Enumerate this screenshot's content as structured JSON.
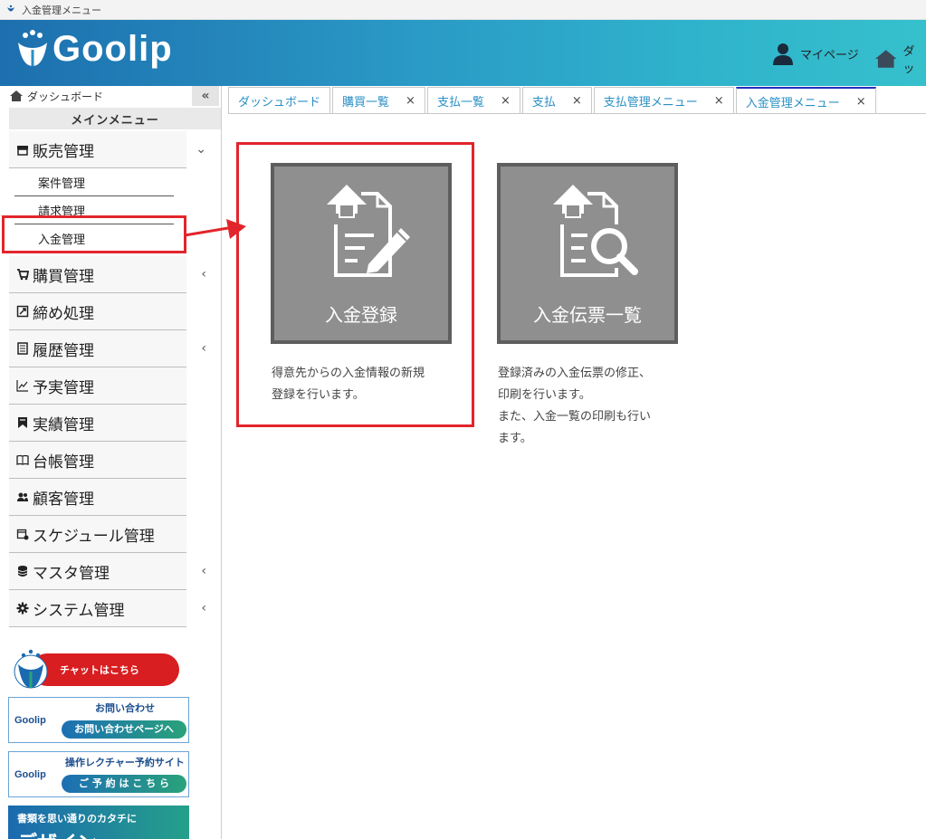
{
  "window": {
    "title": "入金管理メニュー"
  },
  "header": {
    "logo_text": "Goolip",
    "mypage_label": "マイページ",
    "dashboard_label": "ダッ"
  },
  "sidebar": {
    "top_label": "ダッシュボード",
    "collapse_label": "«",
    "main_menu_label": "メインメニュー",
    "items": [
      {
        "label": "販売管理",
        "icon": "store-icon",
        "chevron": "⌄"
      },
      {
        "label": "購買管理",
        "icon": "cart-icon",
        "chevron": "‹"
      },
      {
        "label": "締め処理",
        "icon": "close-process-icon",
        "chevron": ""
      },
      {
        "label": "履歴管理",
        "icon": "history-icon",
        "chevron": "‹"
      },
      {
        "label": "予実管理",
        "icon": "chart-icon",
        "chevron": ""
      },
      {
        "label": "実績管理",
        "icon": "bookmark-icon",
        "chevron": ""
      },
      {
        "label": "台帳管理",
        "icon": "book-icon",
        "chevron": ""
      },
      {
        "label": "顧客管理",
        "icon": "users-icon",
        "chevron": ""
      },
      {
        "label": "スケジュール管理",
        "icon": "calendar-icon",
        "chevron": ""
      },
      {
        "label": "マスタ管理",
        "icon": "database-icon",
        "chevron": "‹"
      },
      {
        "label": "システム管理",
        "icon": "gear-icon",
        "chevron": "‹"
      }
    ],
    "sub_items": [
      {
        "label": "案件管理"
      },
      {
        "label": "請求管理"
      },
      {
        "label": "入金管理"
      }
    ]
  },
  "banners": {
    "chat": "チャットはこちら",
    "inquiry_logo": "Goolip",
    "inquiry_title": "お問い合わせ",
    "inquiry_button": "お問い合わせページへ",
    "lecture_logo": "Goolip",
    "lecture_title": "操作レクチャー予約サイト",
    "lecture_button": "ご 予 約 は こ ち ら",
    "design_line1": "書類を思い通りのカタチに",
    "design_line2": "デザイン"
  },
  "tabs": [
    {
      "label": "ダッシュボード",
      "closable": false
    },
    {
      "label": "購買一覧",
      "closable": true
    },
    {
      "label": "支払一覧",
      "closable": true
    },
    {
      "label": "支払",
      "closable": true
    },
    {
      "label": "支払管理メニュー",
      "closable": true
    },
    {
      "label": "入金管理メニュー",
      "closable": true,
      "active": true
    }
  ],
  "tab_close_glyph": "×",
  "content": {
    "tiles": [
      {
        "label": "入金登録",
        "icon": "payment-edit-icon",
        "description_lines": [
          "得意先からの入金情報の新規",
          "登録を行います。"
        ]
      },
      {
        "label": "入金伝票一覧",
        "icon": "payment-search-icon",
        "description_lines": [
          "登録済みの入金伝票の修正、",
          "印刷を行います。",
          "また、入金一覧の印刷も行い",
          "ます。"
        ]
      }
    ]
  },
  "colors": {
    "header_start": "#1d6fae",
    "header_end": "#36c0cc",
    "tile_bg": "#8f8f8f",
    "highlight": "#e2252b",
    "tab_text": "#2a8fc4",
    "active_tab_border": "#1f2fbf"
  }
}
